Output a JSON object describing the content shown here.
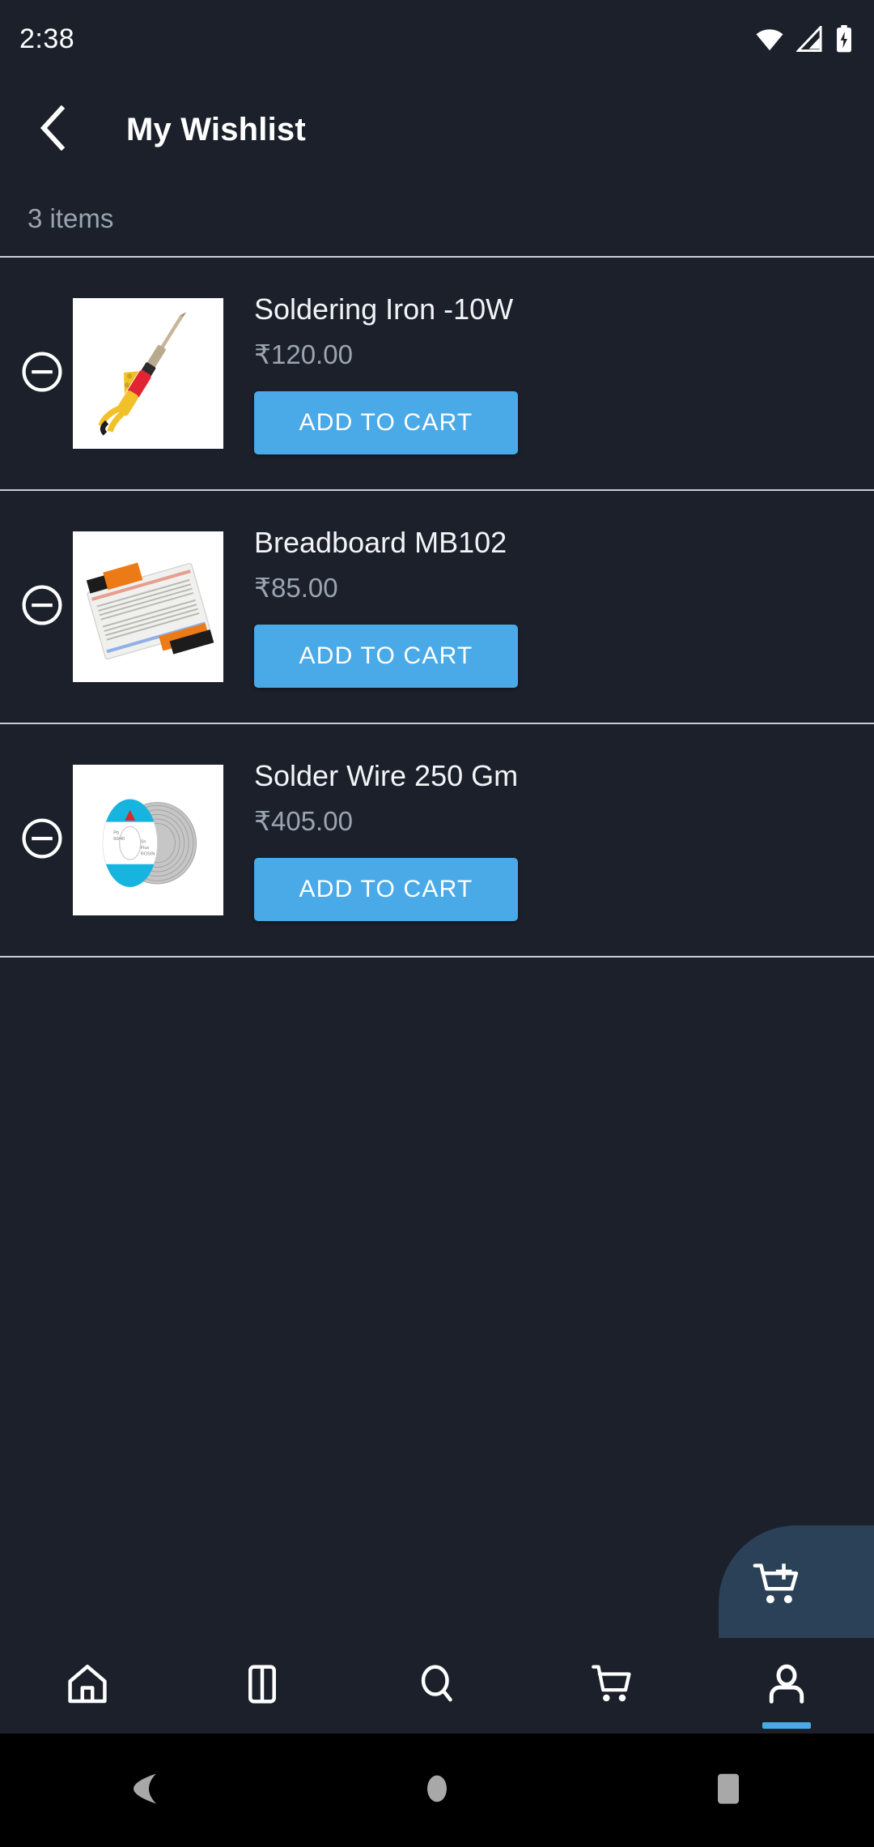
{
  "status_bar": {
    "time": "2:38",
    "icons": [
      "wifi-icon",
      "cellular-signal-icon",
      "battery-charging-icon"
    ]
  },
  "app_bar": {
    "back_icon": "chevron-left-icon",
    "title": "My Wishlist"
  },
  "summary": {
    "item_count_text": "3 items"
  },
  "wishlist": {
    "items": [
      {
        "remove_icon": "minus-circle-icon",
        "image_name": "soldering-iron-photo",
        "name": "Soldering Iron -10W",
        "price": "₹120.00",
        "add_to_cart_label": "ADD TO CART"
      },
      {
        "remove_icon": "minus-circle-icon",
        "image_name": "breadboard-photo",
        "name": "Breadboard MB102",
        "price": "₹85.00",
        "add_to_cart_label": "ADD TO CART"
      },
      {
        "remove_icon": "minus-circle-icon",
        "image_name": "solder-wire-spool-photo",
        "name": "Solder Wire 250 Gm",
        "price": "₹405.00",
        "add_to_cart_label": "ADD TO CART"
      }
    ]
  },
  "fab": {
    "icon": "add-to-cart-icon"
  },
  "bottom_nav": {
    "items": [
      {
        "icon": "home-icon",
        "active": false
      },
      {
        "icon": "categories-icon",
        "active": false
      },
      {
        "icon": "search-icon",
        "active": false
      },
      {
        "icon": "cart-icon",
        "active": false
      },
      {
        "icon": "profile-icon",
        "active": true
      }
    ]
  },
  "android_nav": {
    "items": [
      "back-triangle-icon",
      "home-circle-icon",
      "recents-square-icon"
    ]
  },
  "colors": {
    "background": "#1b202b",
    "accent": "#4aaae8",
    "fab_background": "#2b4157",
    "divider": "#c9ced6",
    "muted_text": "#9aa5b1",
    "primary_text": "#ffffff"
  }
}
